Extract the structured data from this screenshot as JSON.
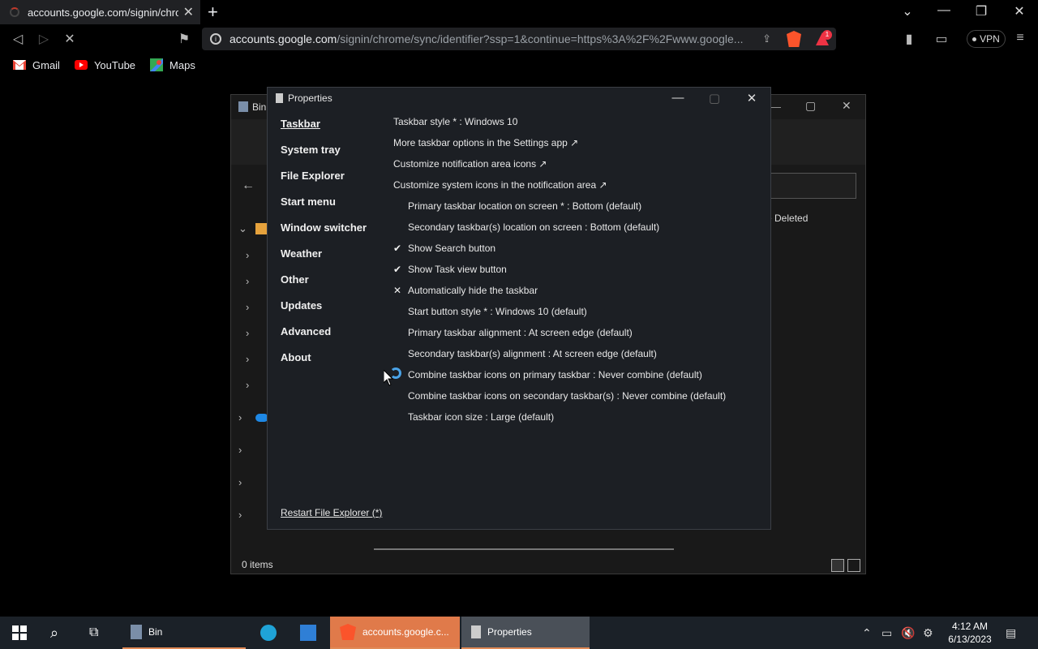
{
  "browser": {
    "tab_title": "accounts.google.com/signin/chro",
    "url_host": "accounts.google.com",
    "url_rest": "/signin/chrome/sync/identifier?ssp=1&continue=https%3A%2F%2Fwww.google...",
    "rewards_badge": "1",
    "vpn_label": "VPN",
    "bookmarks": [
      "Gmail",
      "YouTube",
      "Maps"
    ]
  },
  "explorer": {
    "title": "Bin",
    "partial_column": "e Deleted",
    "status": "0 items"
  },
  "properties": {
    "title": "Properties",
    "nav": [
      "Taskbar",
      "System tray",
      "File Explorer",
      "Start menu",
      "Window switcher",
      "Weather",
      "Other",
      "Updates",
      "Advanced",
      "About"
    ],
    "options": [
      {
        "text": "Taskbar style * : Windows 10",
        "mark": "",
        "indent": false
      },
      {
        "text": "More taskbar options in the Settings app ↗",
        "mark": "",
        "indent": false
      },
      {
        "text": "Customize notification area icons ↗",
        "mark": "",
        "indent": false
      },
      {
        "text": "Customize system icons in the notification area ↗",
        "mark": "",
        "indent": false
      },
      {
        "text": "Primary taskbar location on screen * : Bottom (default)",
        "mark": "",
        "indent": true
      },
      {
        "text": "Secondary taskbar(s) location on screen : Bottom (default)",
        "mark": "",
        "indent": true
      },
      {
        "text": "Show Search button",
        "mark": "✔",
        "indent": true
      },
      {
        "text": "Show Task view button",
        "mark": "✔",
        "indent": true
      },
      {
        "text": "Automatically hide the taskbar",
        "mark": "✕",
        "indent": true
      },
      {
        "text": "Start button style * : Windows 10 (default)",
        "mark": "",
        "indent": true
      },
      {
        "text": "Primary taskbar alignment : At screen edge (default)",
        "mark": "",
        "indent": true
      },
      {
        "text": "Secondary taskbar(s) alignment : At screen edge (default)",
        "mark": "",
        "indent": true
      },
      {
        "text": "Combine taskbar icons on primary taskbar : Never combine (default)",
        "mark": "",
        "indent": true
      },
      {
        "text": "Combine taskbar icons on secondary taskbar(s) : Never combine (default)",
        "mark": "",
        "indent": true
      },
      {
        "text": "Taskbar icon size : Large (default)",
        "mark": "",
        "indent": true
      }
    ],
    "restart_link": "Restart File Explorer (*)"
  },
  "taskbar": {
    "items": [
      "Bin",
      "accounts.google.c...",
      "Properties"
    ],
    "time": "4:12 AM",
    "date": "6/13/2023"
  }
}
